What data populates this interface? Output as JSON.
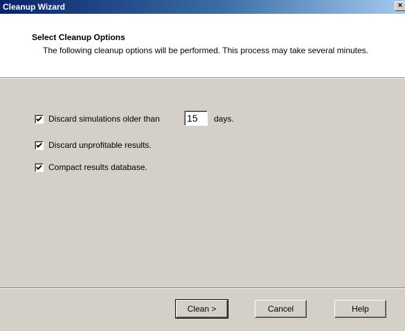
{
  "window": {
    "title": "Cleanup Wizard",
    "close_glyph": "×"
  },
  "header": {
    "title": "Select Cleanup Options",
    "description": "The following cleanup options will be performed. This process may take several minutes."
  },
  "options": [
    {
      "checked": true,
      "label": "Discard simulations older than",
      "days_value": "15",
      "days_suffix": "days."
    },
    {
      "checked": true,
      "label": "Discard unprofitable results."
    },
    {
      "checked": true,
      "label": "Compact results database."
    }
  ],
  "buttons": {
    "clean": "Clean >",
    "cancel": "Cancel",
    "help": "Help"
  },
  "colors": {
    "face": "#d4d0c8",
    "title_start": "#0a246a",
    "title_end": "#a6caf0"
  }
}
